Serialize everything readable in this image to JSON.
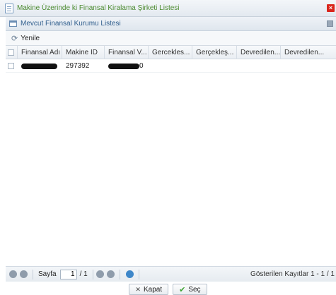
{
  "window": {
    "title": "Makine Üzerinde ki Finansal Kiralama Şirketi Listesi",
    "close_glyph": "×"
  },
  "panel": {
    "title": "Mevcut Finansal Kurumu Listesi"
  },
  "toolbar": {
    "refresh_label": "Yenile",
    "refresh_glyph": "⟳"
  },
  "grid": {
    "columns": [
      "Finansal Adı",
      "Makine ID",
      "Finansal V...",
      "Gercekles...",
      "Gerçekleş...",
      "Devredilen...",
      "Devredilen..."
    ],
    "rows": [
      {
        "finansal_adi": "",
        "makine_id": "297392",
        "finansal_v_suffix": "0"
      }
    ]
  },
  "pager": {
    "page_word": "Sayfa",
    "current_page": "1",
    "of_text": "/ 1",
    "display_info": "Gösterilen Kayıtlar 1 - 1 / 1"
  },
  "buttons": {
    "close_label": "Kapat",
    "close_glyph": "✕",
    "select_label": "Seç",
    "select_glyph": "✔"
  },
  "colors": {
    "window_title": "#4a8a2e",
    "panel_title": "#2f5d8c",
    "close_red": "#d9261c",
    "pager_refresh_blue": "#3e87c9",
    "select_check_green": "#3aa12f"
  }
}
